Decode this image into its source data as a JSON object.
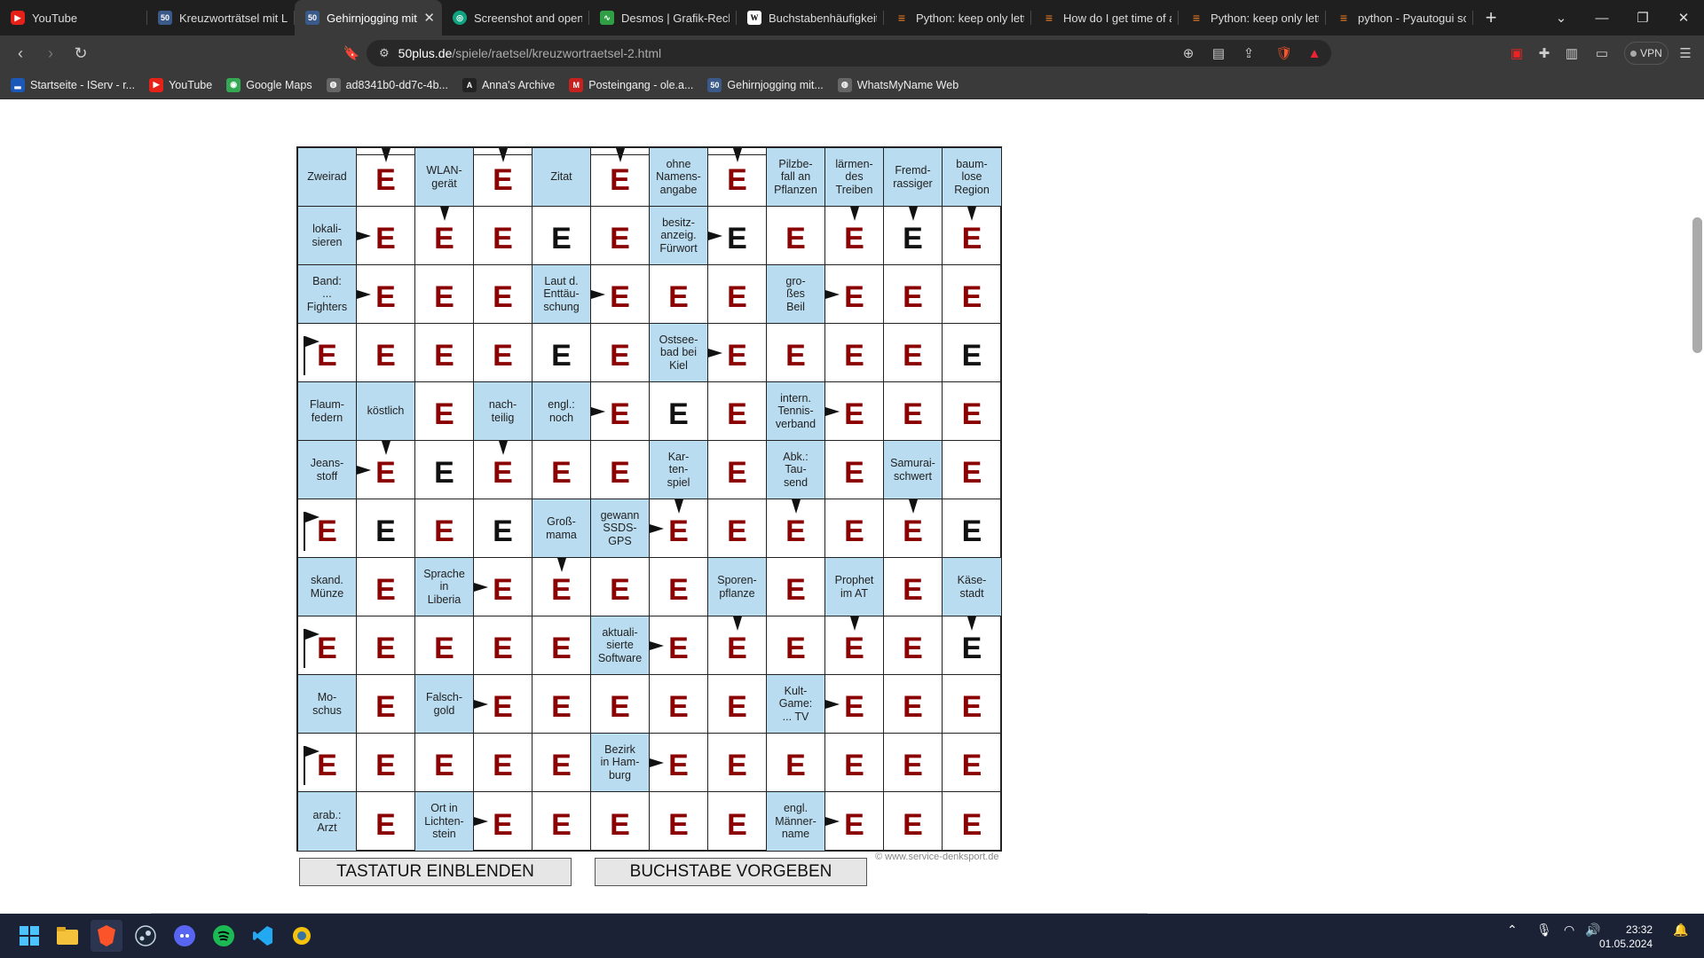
{
  "browser": {
    "tabs": [
      {
        "title": "YouTube",
        "icon": "youtube"
      },
      {
        "title": "Kreuzworträtsel mit Lö",
        "icon": "fifty"
      },
      {
        "title": "Gehirnjogging mit",
        "icon": "fifty",
        "active": true
      },
      {
        "title": "Screenshot and open",
        "icon": "chatgpt"
      },
      {
        "title": "Desmos | Grafik-Rechn",
        "icon": "desmos"
      },
      {
        "title": "Buchstabenhäufigkeit",
        "icon": "wikipedia"
      },
      {
        "title": "Python: keep only lette",
        "icon": "stackoverflow"
      },
      {
        "title": "How do I get time of a",
        "icon": "stackoverflow"
      },
      {
        "title": "Python: keep only lette",
        "icon": "stackoverflow"
      },
      {
        "title": "python - Pyautogui sc",
        "icon": "stackoverflow"
      }
    ],
    "address": {
      "host": "50plus.de",
      "path": "/spiele/raetsel/kreuzwortraetsel-2.html"
    },
    "vpn_label": "VPN",
    "bookmarks": [
      {
        "label": "Startseite - IServ - r...",
        "icon": "iserv"
      },
      {
        "label": "YouTube",
        "icon": "youtube"
      },
      {
        "label": "Google Maps",
        "icon": "maps"
      },
      {
        "label": "ad8341b0-dd7c-4b...",
        "icon": "globe"
      },
      {
        "label": "Anna's Archive",
        "icon": "anna"
      },
      {
        "label": "Posteingang - ole.a...",
        "icon": "gmail"
      },
      {
        "label": "Gehirnjogging mit...",
        "icon": "fifty"
      },
      {
        "label": "WhatsMyName Web",
        "icon": "globe"
      }
    ]
  },
  "puzzle": {
    "rows": [
      [
        {
          "c": "Zweirad"
        },
        {
          "l": "E",
          "d": 1
        },
        {
          "c": "WLAN-\ngerät"
        },
        {
          "l": "E",
          "d": 1
        },
        {
          "c": "Zitat"
        },
        {
          "l": "E",
          "d": 1
        },
        {
          "c": "ohne\nNamens-\nangabe"
        },
        {
          "l": "E",
          "d": 1
        },
        {
          "c": "Pilzbe-\nfall an\nPflanzen"
        },
        {
          "c": "lärmen-\ndes\nTreiben"
        },
        {
          "c": "Fremd-\nrassiger"
        },
        {
          "c": "baum-\nlose\nRegion"
        }
      ],
      [
        {
          "c": "lokali-\nsieren"
        },
        {
          "l": "E",
          "r": 1
        },
        {
          "l": "E",
          "d": 1
        },
        {
          "l": "E"
        },
        {
          "l": "E",
          "k": 1
        },
        {
          "l": "E"
        },
        {
          "c": "besitz-\nanzeig.\nFürwort"
        },
        {
          "l": "E",
          "r": 1,
          "k": 1
        },
        {
          "l": "E"
        },
        {
          "l": "E",
          "d": 1
        },
        {
          "l": "E",
          "d": 1,
          "k": 1
        },
        {
          "l": "E",
          "d": 1
        }
      ],
      [
        {
          "c": "Band:\n...\nFighters"
        },
        {
          "l": "E",
          "r": 1
        },
        {
          "l": "E"
        },
        {
          "l": "E"
        },
        {
          "c": "Laut d.\nEnttäu-\nschung"
        },
        {
          "l": "E",
          "r": 1
        },
        {
          "l": "E"
        },
        {
          "l": "E"
        },
        {
          "c": "gro-\nßes\nBeil"
        },
        {
          "l": "E",
          "r": 1
        },
        {
          "l": "E"
        },
        {
          "l": "E"
        }
      ],
      [
        {
          "l": "E",
          "f": 1
        },
        {
          "l": "E"
        },
        {
          "l": "E"
        },
        {
          "l": "E"
        },
        {
          "l": "E",
          "k": 1
        },
        {
          "l": "E"
        },
        {
          "c": "Ostsee-\nbad bei\nKiel"
        },
        {
          "l": "E",
          "r": 1
        },
        {
          "l": "E"
        },
        {
          "l": "E"
        },
        {
          "l": "E"
        },
        {
          "l": "E",
          "k": 1
        }
      ],
      [
        {
          "c": "Flaum-\nfedern"
        },
        {
          "c": "köstlich"
        },
        {
          "l": "E"
        },
        {
          "c": "nach-\nteilig"
        },
        {
          "c": "engl.:\nnoch"
        },
        {
          "l": "E",
          "r": 1
        },
        {
          "l": "E",
          "k": 1
        },
        {
          "l": "E"
        },
        {
          "c": "intern.\nTennis-\nverband"
        },
        {
          "l": "E",
          "r": 1
        },
        {
          "l": "E"
        },
        {
          "l": "E"
        }
      ],
      [
        {
          "c": "Jeans-\nstoff"
        },
        {
          "l": "E",
          "r": 1,
          "d": 1
        },
        {
          "l": "E",
          "k": 1
        },
        {
          "l": "E",
          "d": 1
        },
        {
          "l": "E"
        },
        {
          "l": "E"
        },
        {
          "c": "Kar-\nten-\nspiel"
        },
        {
          "l": "E"
        },
        {
          "c": "Abk.:\nTau-\nsend"
        },
        {
          "l": "E"
        },
        {
          "c": "Samurai-\nschwert"
        },
        {
          "l": "E"
        }
      ],
      [
        {
          "l": "E",
          "f": 1
        },
        {
          "l": "E",
          "k": 1
        },
        {
          "l": "E"
        },
        {
          "l": "E",
          "k": 1
        },
        {
          "c": "Groß-\nmama"
        },
        {
          "c": "gewann\nSSDS-\nGPS"
        },
        {
          "l": "E",
          "r": 1,
          "d": 1
        },
        {
          "l": "E"
        },
        {
          "l": "E",
          "d": 1
        },
        {
          "l": "E"
        },
        {
          "l": "E",
          "d": 1
        },
        {
          "l": "E",
          "k": 1
        }
      ],
      [
        {
          "c": "skand.\nMünze"
        },
        {
          "l": "E"
        },
        {
          "c": "Sprache\nin\nLiberia"
        },
        {
          "l": "E",
          "r": 1
        },
        {
          "l": "E",
          "d": 1
        },
        {
          "l": "E"
        },
        {
          "l": "E"
        },
        {
          "c": "Sporen-\npflanze"
        },
        {
          "l": "E"
        },
        {
          "c": "Prophet\nim AT"
        },
        {
          "l": "E"
        },
        {
          "c": "Käse-\nstadt"
        }
      ],
      [
        {
          "l": "E",
          "f": 1
        },
        {
          "l": "E"
        },
        {
          "l": "E"
        },
        {
          "l": "E"
        },
        {
          "l": "E"
        },
        {
          "c": "aktuali-\nsierte\nSoftware"
        },
        {
          "l": "E",
          "r": 1
        },
        {
          "l": "E",
          "d": 1
        },
        {
          "l": "E"
        },
        {
          "l": "E",
          "d": 1
        },
        {
          "l": "E"
        },
        {
          "l": "E",
          "d": 1,
          "k": 1
        }
      ],
      [
        {
          "c": "Mo-\nschus"
        },
        {
          "l": "E"
        },
        {
          "c": "Falsch-\ngold"
        },
        {
          "l": "E",
          "r": 1
        },
        {
          "l": "E"
        },
        {
          "l": "E"
        },
        {
          "l": "E"
        },
        {
          "l": "E"
        },
        {
          "c": "Kult-\nGame:\n... TV"
        },
        {
          "l": "E",
          "r": 1
        },
        {
          "l": "E"
        },
        {
          "l": "E"
        }
      ],
      [
        {
          "l": "E",
          "f": 1
        },
        {
          "l": "E"
        },
        {
          "l": "E"
        },
        {
          "l": "E"
        },
        {
          "l": "E"
        },
        {
          "c": "Bezirk\nin Ham-\nburg"
        },
        {
          "l": "E",
          "r": 1
        },
        {
          "l": "E"
        },
        {
          "l": "E"
        },
        {
          "l": "E"
        },
        {
          "l": "E"
        },
        {
          "l": "E"
        }
      ],
      [
        {
          "c": "arab.:\nArzt"
        },
        {
          "l": "E"
        },
        {
          "c": "Ort in\nLichten-\nstein"
        },
        {
          "l": "E",
          "r": 1
        },
        {
          "l": "E"
        },
        {
          "l": "E"
        },
        {
          "l": "E"
        },
        {
          "l": "E"
        },
        {
          "c": "engl.\nMänner-\nname"
        },
        {
          "l": "E",
          "r": 1
        },
        {
          "l": "E"
        },
        {
          "l": "E"
        }
      ]
    ],
    "buttons": {
      "keyboard": "TASTATUR EINBLENDEN",
      "reveal": "BUCHSTABE VORGEBEN"
    },
    "copyright": "© www.service-denksport.de"
  },
  "taskbar": {
    "apps": [
      "windows-start",
      "file-explorer",
      "brave",
      "steam",
      "discord",
      "spotify",
      "vscode",
      "python-idle"
    ],
    "clock": {
      "time": "23:32",
      "date": "01.05.2024"
    }
  }
}
